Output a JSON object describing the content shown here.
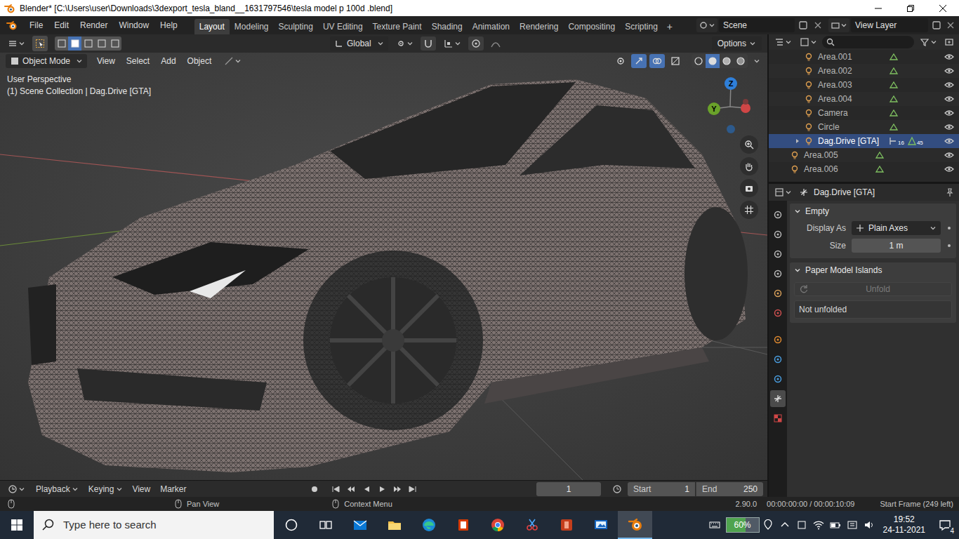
{
  "window": {
    "title": "Blender* [C:\\Users\\user\\Downloads\\3dexport_tesla_bland__1631797546\\tesla model p 100d .blend]"
  },
  "menu": [
    "File",
    "Edit",
    "Render",
    "Window",
    "Help"
  ],
  "workspaces": [
    {
      "label": "Layout",
      "selected": true
    },
    {
      "label": "Modeling",
      "selected": false
    },
    {
      "label": "Sculpting",
      "selected": false
    },
    {
      "label": "UV Editing",
      "selected": false
    },
    {
      "label": "Texture Paint",
      "selected": false
    },
    {
      "label": "Shading",
      "selected": false
    },
    {
      "label": "Animation",
      "selected": false
    },
    {
      "label": "Rendering",
      "selected": false
    },
    {
      "label": "Compositing",
      "selected": false
    },
    {
      "label": "Scripting",
      "selected": false
    }
  ],
  "add_workspace": "+",
  "scene": "Scene",
  "view_layer": "View Layer",
  "tool_header": {
    "orientation": "Global",
    "options": "Options",
    "select_modes": [
      {
        "selected": false
      },
      {
        "selected": true
      },
      {
        "selected": false
      },
      {
        "selected": false
      },
      {
        "selected": false
      }
    ]
  },
  "viewport_header": {
    "mode": "Object Mode",
    "menus": [
      "View",
      "Select",
      "Add",
      "Object"
    ],
    "toggles": [
      {
        "on": false
      },
      {
        "on": true
      },
      {
        "on": true
      },
      {
        "on": false
      }
    ],
    "shading": [
      {
        "selected": false
      },
      {
        "selected": true
      },
      {
        "selected": false
      },
      {
        "selected": false
      }
    ]
  },
  "viewport": {
    "perspective": "User Perspective",
    "context": "(1) Scene Collection | Dag.Drive [GTA]",
    "gizmo": [
      {
        "label": "Z",
        "color": "#2f7fd9"
      },
      {
        "label": "Y",
        "color": "#6aa22a"
      }
    ]
  },
  "outliner": {
    "items": [
      {
        "name": "Area.001",
        "selected": false,
        "kind": "child"
      },
      {
        "name": "Area.002",
        "selected": false,
        "kind": "child"
      },
      {
        "name": "Area.003",
        "selected": false,
        "kind": "child"
      },
      {
        "name": "Area.004",
        "selected": false,
        "kind": "child"
      },
      {
        "name": "Camera",
        "selected": false,
        "kind": "child"
      },
      {
        "name": "Circle",
        "selected": false,
        "kind": "child"
      },
      {
        "name": "Dag.Drive [GTA]",
        "selected": true,
        "kind": "parent",
        "badges": [
          "16",
          "45"
        ]
      },
      {
        "name": "Area.005",
        "selected": false,
        "kind": "root"
      },
      {
        "name": "Area.006",
        "selected": false,
        "kind": "root"
      }
    ]
  },
  "properties": {
    "object": "Dag.Drive [GTA]",
    "tabs": [
      {
        "selected": false
      },
      {
        "selected": false
      },
      {
        "selected": false
      },
      {
        "selected": false
      },
      {
        "selected": false
      },
      {
        "selected": false
      },
      {
        "selected": false
      },
      {
        "selected": false
      },
      {
        "selected": false
      },
      {
        "selected": true
      },
      {
        "selected": false
      }
    ],
    "empty_panel": {
      "title": "Empty",
      "expanded": true,
      "fields": [
        {
          "label": "Display As",
          "value": "Plain Axes",
          "kind": "dropdown"
        },
        {
          "label": "Size",
          "value": "1 m",
          "kind": "number"
        }
      ]
    },
    "paper_panel": {
      "title": "Paper Model Islands",
      "expanded": true,
      "button": {
        "label": "Unfold",
        "disabled": true
      },
      "note": "Not unfolded"
    }
  },
  "timeline": {
    "menus": [
      "Playback",
      "Keying",
      "View",
      "Marker"
    ],
    "current": "1",
    "start_label": "Start",
    "start": "1",
    "end_label": "End",
    "end": "250"
  },
  "status": {
    "actions": [
      "Pan View",
      "Context Menu"
    ],
    "version": "2.90.0",
    "time": "00:00:00:00 / 00:00:10:09",
    "start_frame": "Start Frame (249 left)"
  },
  "taskbar": {
    "search": "Type here to search",
    "apps": [
      {
        "open": false
      },
      {
        "open": false
      },
      {
        "open": false
      },
      {
        "open": false
      },
      {
        "open": false
      },
      {
        "open": false
      },
      {
        "open": false
      },
      {
        "open": false
      },
      {
        "open": false
      },
      {
        "open": false
      },
      {
        "open": true
      }
    ],
    "battery": {
      "text": "60%",
      "level": 0.6
    },
    "time": "19:52",
    "date": "24-11-2021",
    "notifications": "4"
  }
}
